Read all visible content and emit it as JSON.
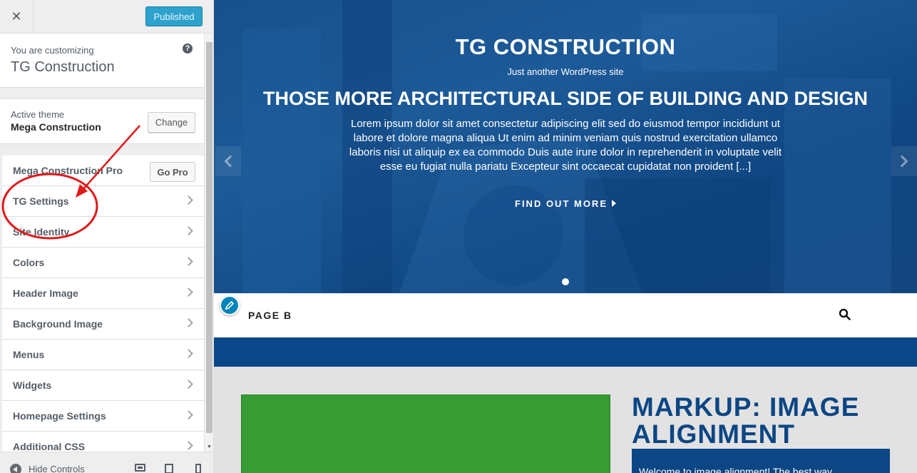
{
  "sidebar": {
    "header": {
      "close_icon": "close-icon",
      "publish_label": "Published"
    },
    "info": {
      "small": "You are customizing",
      "title": "TG Construction",
      "help_icon": "help-icon"
    },
    "theme": {
      "label": "Active theme",
      "name": "Mega Construction",
      "change_label": "Change"
    },
    "panels": [
      {
        "label": "Mega Construction Pro",
        "button": "Go Pro"
      },
      {
        "label": "TG Settings"
      },
      {
        "label": "Site Identity"
      },
      {
        "label": "Colors"
      },
      {
        "label": "Header Image"
      },
      {
        "label": "Background Image"
      },
      {
        "label": "Menus"
      },
      {
        "label": "Widgets"
      },
      {
        "label": "Homepage Settings"
      },
      {
        "label": "Additional CSS"
      }
    ],
    "footer": {
      "hide_label": "Hide Controls"
    }
  },
  "preview": {
    "hero": {
      "site_title": "TG CONSTRUCTION",
      "tagline": "Just another WordPress site",
      "heading": "THOSE MORE ARCHITECTURAL SIDE OF BUILDING AND DESIGN",
      "text": "Lorem ipsum dolor sit amet consectetur adipiscing elit sed do eiusmod tempor incididunt ut labore et dolore magna aliqua Ut enim ad minim veniam quis nostrud exercitation ullamco laboris nisi ut aliquip ex ea commodo Duis aute irure dolor in reprehenderit in voluptate velit esse eu fugiat nulla pariatu Excepteur sint occaecat cupidatat non proident [...]",
      "cta": "FIND OUT MORE"
    },
    "nav": {
      "item": "PAGE B"
    },
    "post": {
      "title": "MARKUP: IMAGE ALIGNMENT",
      "excerpt": "Welcome to image alignment! The best way"
    }
  },
  "colors": {
    "accent": "#0085ba",
    "publish": "#2ea2cc",
    "hero_blue": "#17508c",
    "strip_blue": "#0a4789",
    "featured_green": "#369c33",
    "annotation_red": "#e0191b"
  }
}
